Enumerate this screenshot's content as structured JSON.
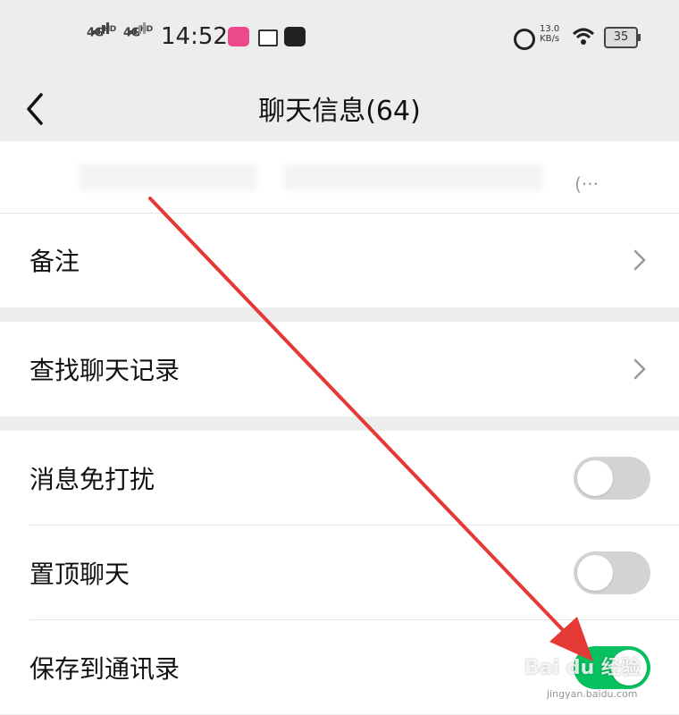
{
  "status_bar": {
    "net1": "4G",
    "net1_sup": "HD",
    "net2": "4G",
    "net2_sup": "HD",
    "time": "14:52",
    "speed_value": "13.0",
    "speed_unit": "KB/s",
    "battery": "35",
    "icons": [
      "signal-icon",
      "app-notification-icon",
      "toutiao-icon",
      "message-icon",
      "alarm-icon",
      "wifi-icon",
      "battery-icon"
    ]
  },
  "nav": {
    "title": "聊天信息(64)",
    "back_icon": "chevron-left-icon"
  },
  "members": {
    "more": "(···"
  },
  "settings": {
    "remark_label": "备注",
    "search_label": "查找聊天记录",
    "mute_label": "消息免打扰",
    "mute_on": false,
    "pin_label": "置顶聊天",
    "pin_on": false,
    "save_label": "保存到通讯录",
    "save_on": true
  },
  "colors": {
    "background": "#ededed",
    "card": "#ffffff",
    "toggle_on": "#07c160",
    "toggle_off": "#d3d3d3",
    "annotation_arrow": "#e53935"
  },
  "watermark": {
    "text": "Bai du 经验",
    "sub": "jingyan.baidu.com"
  }
}
